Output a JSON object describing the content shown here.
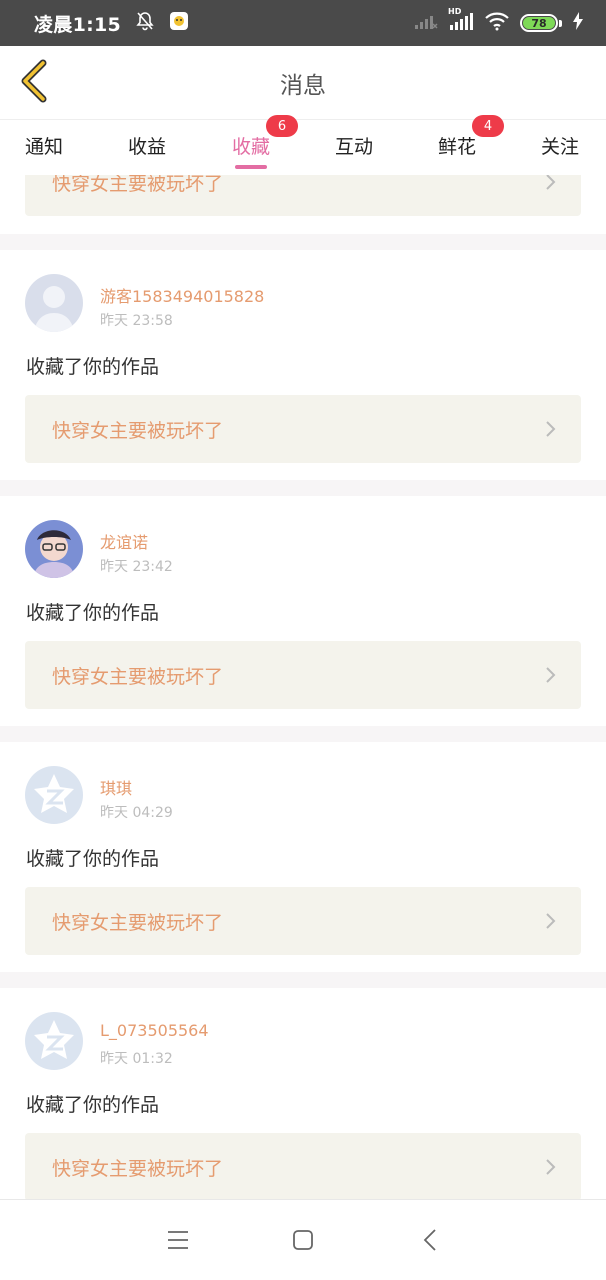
{
  "status_bar": {
    "time": "凌晨1:15",
    "battery": "78",
    "network_label": "HD"
  },
  "header": {
    "title": "消息",
    "back_icon": "chevron-left-icon"
  },
  "tabs": [
    {
      "label": "通知",
      "badge": ""
    },
    {
      "label": "收益",
      "badge": ""
    },
    {
      "label": "收藏",
      "badge": "6",
      "active": true
    },
    {
      "label": "互动",
      "badge": ""
    },
    {
      "label": "鲜花",
      "badge": "4"
    },
    {
      "label": "关注",
      "badge": ""
    }
  ],
  "partial_work_title": "快穿女主要被玩坏了",
  "messages": [
    {
      "username": "游客1583494015828",
      "time": "昨天 23:58",
      "action": "收藏了你的作品",
      "work_title": "快穿女主要被玩坏了",
      "avatar": "default-person-avatar"
    },
    {
      "username": "龙谊诺",
      "time": "昨天 23:42",
      "action": "收藏了你的作品",
      "work_title": "快穿女主要被玩坏了",
      "avatar": "photo-avatar"
    },
    {
      "username": "琪琪",
      "time": "昨天 04:29",
      "action": "收藏了你的作品",
      "work_title": "快穿女主要被玩坏了",
      "avatar": "qq-default-avatar"
    },
    {
      "username": "L_073505564",
      "time": "昨天 01:32",
      "action": "收藏了你的作品",
      "work_title": "快穿女主要被玩坏了",
      "avatar": "qq-default-avatar"
    }
  ],
  "colors": {
    "accent": "#e36da3",
    "username": "#e59b6f",
    "badge": "#ee3b49",
    "work_box": "#f4f3ec"
  },
  "nav": [
    "menu-icon",
    "home-icon",
    "back-icon"
  ]
}
